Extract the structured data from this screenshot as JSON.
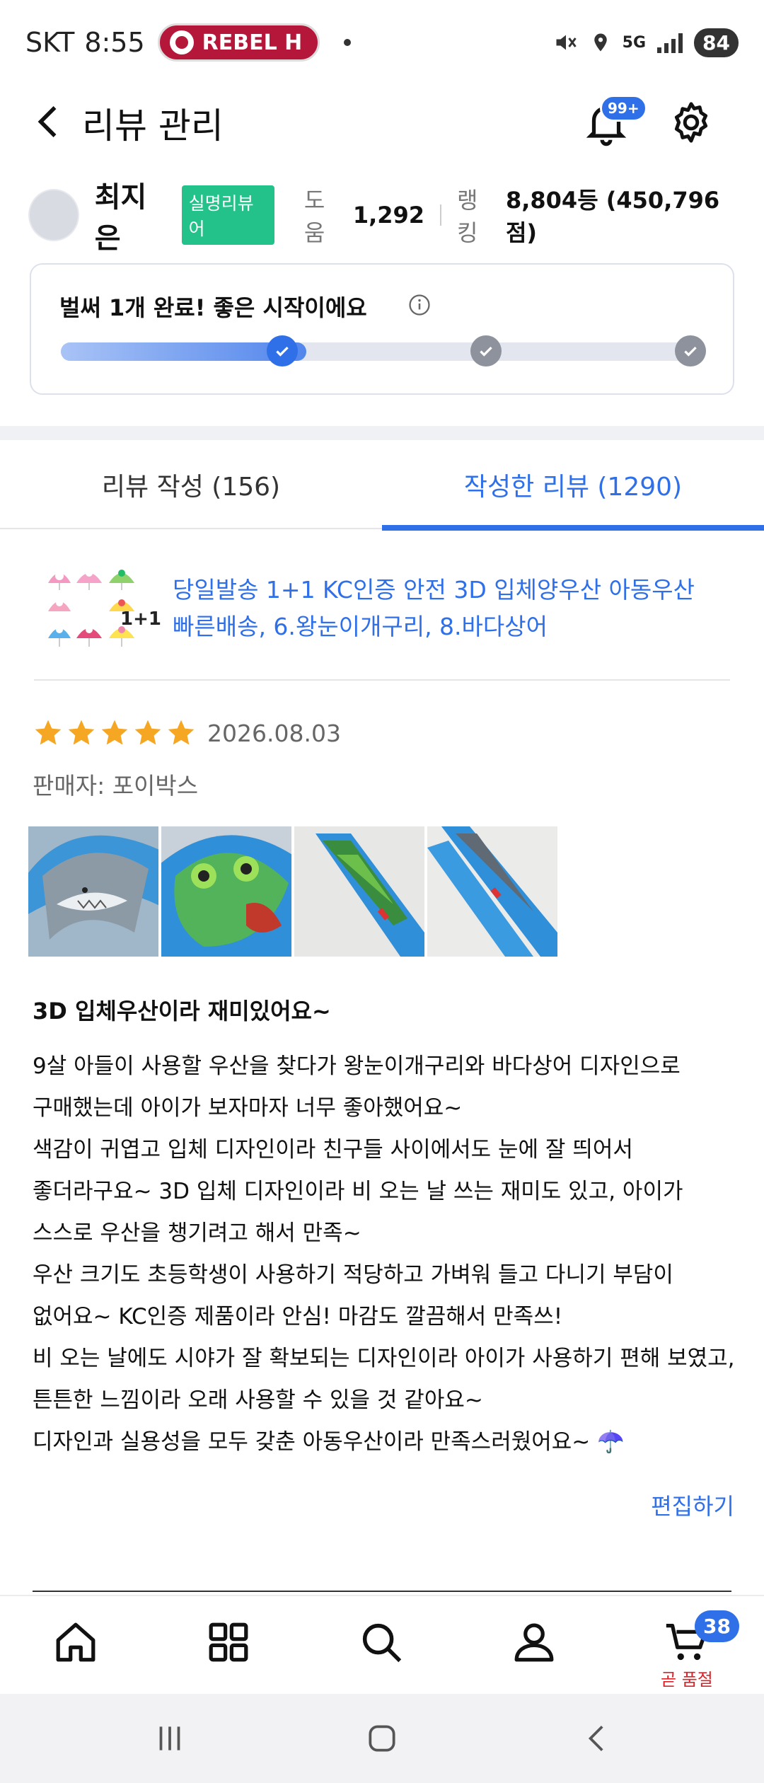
{
  "status_bar": {
    "carrier": "SKT",
    "time": "8:55",
    "media_pill": "REBEL H",
    "network": "5G",
    "battery": "84"
  },
  "header": {
    "title": "리뷰 관리",
    "notification_badge": "99+"
  },
  "profile": {
    "name": "최지은",
    "badge": "실명리뷰어",
    "help_label": "도움",
    "help_value": "1,292",
    "ranking_label": "랭킹",
    "ranking_value": "8,804등 (450,796점)"
  },
  "progress": {
    "title": "벌써 1개 완료! 좋은 시작이에요",
    "fraction": 0.38,
    "steps": [
      "done",
      "todo",
      "todo"
    ]
  },
  "tabs": [
    {
      "label": "리뷰 작성 (156)",
      "active": false
    },
    {
      "label": "작성한 리뷰 (1290)",
      "active": true
    }
  ],
  "product": {
    "name_line1": "당일발송 1+1 KC인증 안전 3D 입체양우산 아동우산",
    "name_line2": "빠른배송, 6.왕눈이개구리, 8.바다상어",
    "thumb_label": "1+1"
  },
  "review": {
    "rating": 5,
    "date": "2026.08.03",
    "seller": "판매자: 포이박스",
    "title": "3D 입체우산이라 재미있어요~",
    "body_lines": [
      "9살 아들이 사용할 우산을 찾다가 왕눈이개구리와 바다상어 디자인으로",
      "구매했는데 아이가 보자마자 너무 좋아했어요~",
      "색감이 귀엽고 입체 디자인이라 친구들 사이에서도 눈에 잘 띄어서",
      "좋더라구요~ 3D 입체 디자인이라 비 오는 날 쓰는 재미도 있고, 아이가",
      "스스로 우산을  챙기려고 해서 만족~",
      "우산 크기도 초등학생이 사용하기 적당하고 가벼워 들고 다니기 부담이",
      "없어요~ KC인증 제품이라 안심! 마감도 깔끔해서 만족쓰!",
      "비 오는 날에도 시야가 잘 확보되는 디자인이라 아이가 사용하기 편해 보였고,",
      "튼튼한 느낌이라 오래 사용할 수 있을 것 같아요~",
      "디자인과 실용성을 모두 갖춘 아동우산이라 만족스러웠어요~ ☂️"
    ],
    "edit_label": "편집하기"
  },
  "bottom_nav": {
    "items": [
      "home-icon",
      "grid-icon",
      "search-icon",
      "user-icon",
      "cart-icon"
    ],
    "cart_badge": "38",
    "cart_sub": "곧 품절"
  },
  "colors": {
    "accent": "#2f6fe8",
    "badge_green": "#22c28a",
    "star": "#f5a623",
    "red": "#d8232a"
  }
}
